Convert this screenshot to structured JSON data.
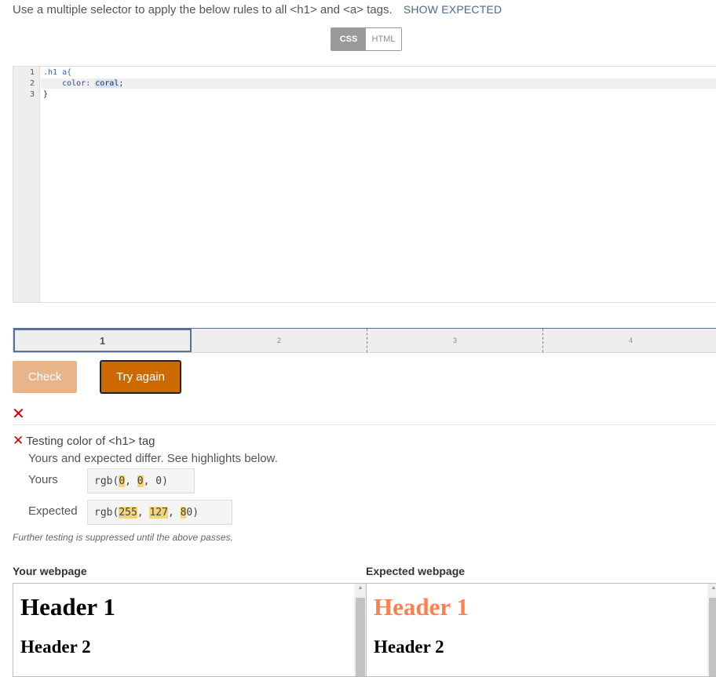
{
  "instructions": {
    "text": "Use a multiple selector to apply the below rules to all <h1> and <a> tags.",
    "show_expected": "SHOW EXPECTED"
  },
  "toggle": {
    "css": "CSS",
    "html": "HTML"
  },
  "editor": {
    "line_numbers": [
      "1",
      "2",
      "3"
    ],
    "line1_selector": ".h1 a{",
    "line2_indent": "    ",
    "line2_property": "color: ",
    "line2_value": "coral",
    "line2_end": ";",
    "line3": "}"
  },
  "progress": {
    "segments": [
      "1",
      "2",
      "3",
      "4"
    ],
    "active": 1
  },
  "buttons": {
    "check": "Check",
    "try_again": "Try again"
  },
  "results": {
    "fail_icon": "✕",
    "test_title": "Testing color of <h1> tag",
    "message": "Yours and expected differ. See highlights below.",
    "yours_label": "Yours",
    "expected_label": "Expected",
    "yours_value": {
      "prefix": "rgb(",
      "v1": "0",
      "sep1": ", ",
      "v2": "0",
      "sep2": ", ",
      "v3": "0",
      "suffix": ")"
    },
    "expected_value": {
      "prefix": "rgb(",
      "v1": "255",
      "sep1": ", ",
      "v2": "127",
      "sep2": ", ",
      "v3a": "8",
      "v3b": "0",
      "suffix": ")"
    },
    "suppressed": "Further testing is suppressed until the above passes."
  },
  "preview": {
    "your_label": "Your webpage",
    "expected_label": "Expected webpage",
    "your_h1": "Header 1",
    "your_h2": "Header 2",
    "expected_h1": "Header 1",
    "expected_h2": "Header 2",
    "expected_h1_color": "#ff7f50"
  },
  "colors": {
    "accent": "#cc6a00",
    "check_disabled": "#e8b48a",
    "fail": "#cc0000",
    "link": "#4a6a8a"
  }
}
